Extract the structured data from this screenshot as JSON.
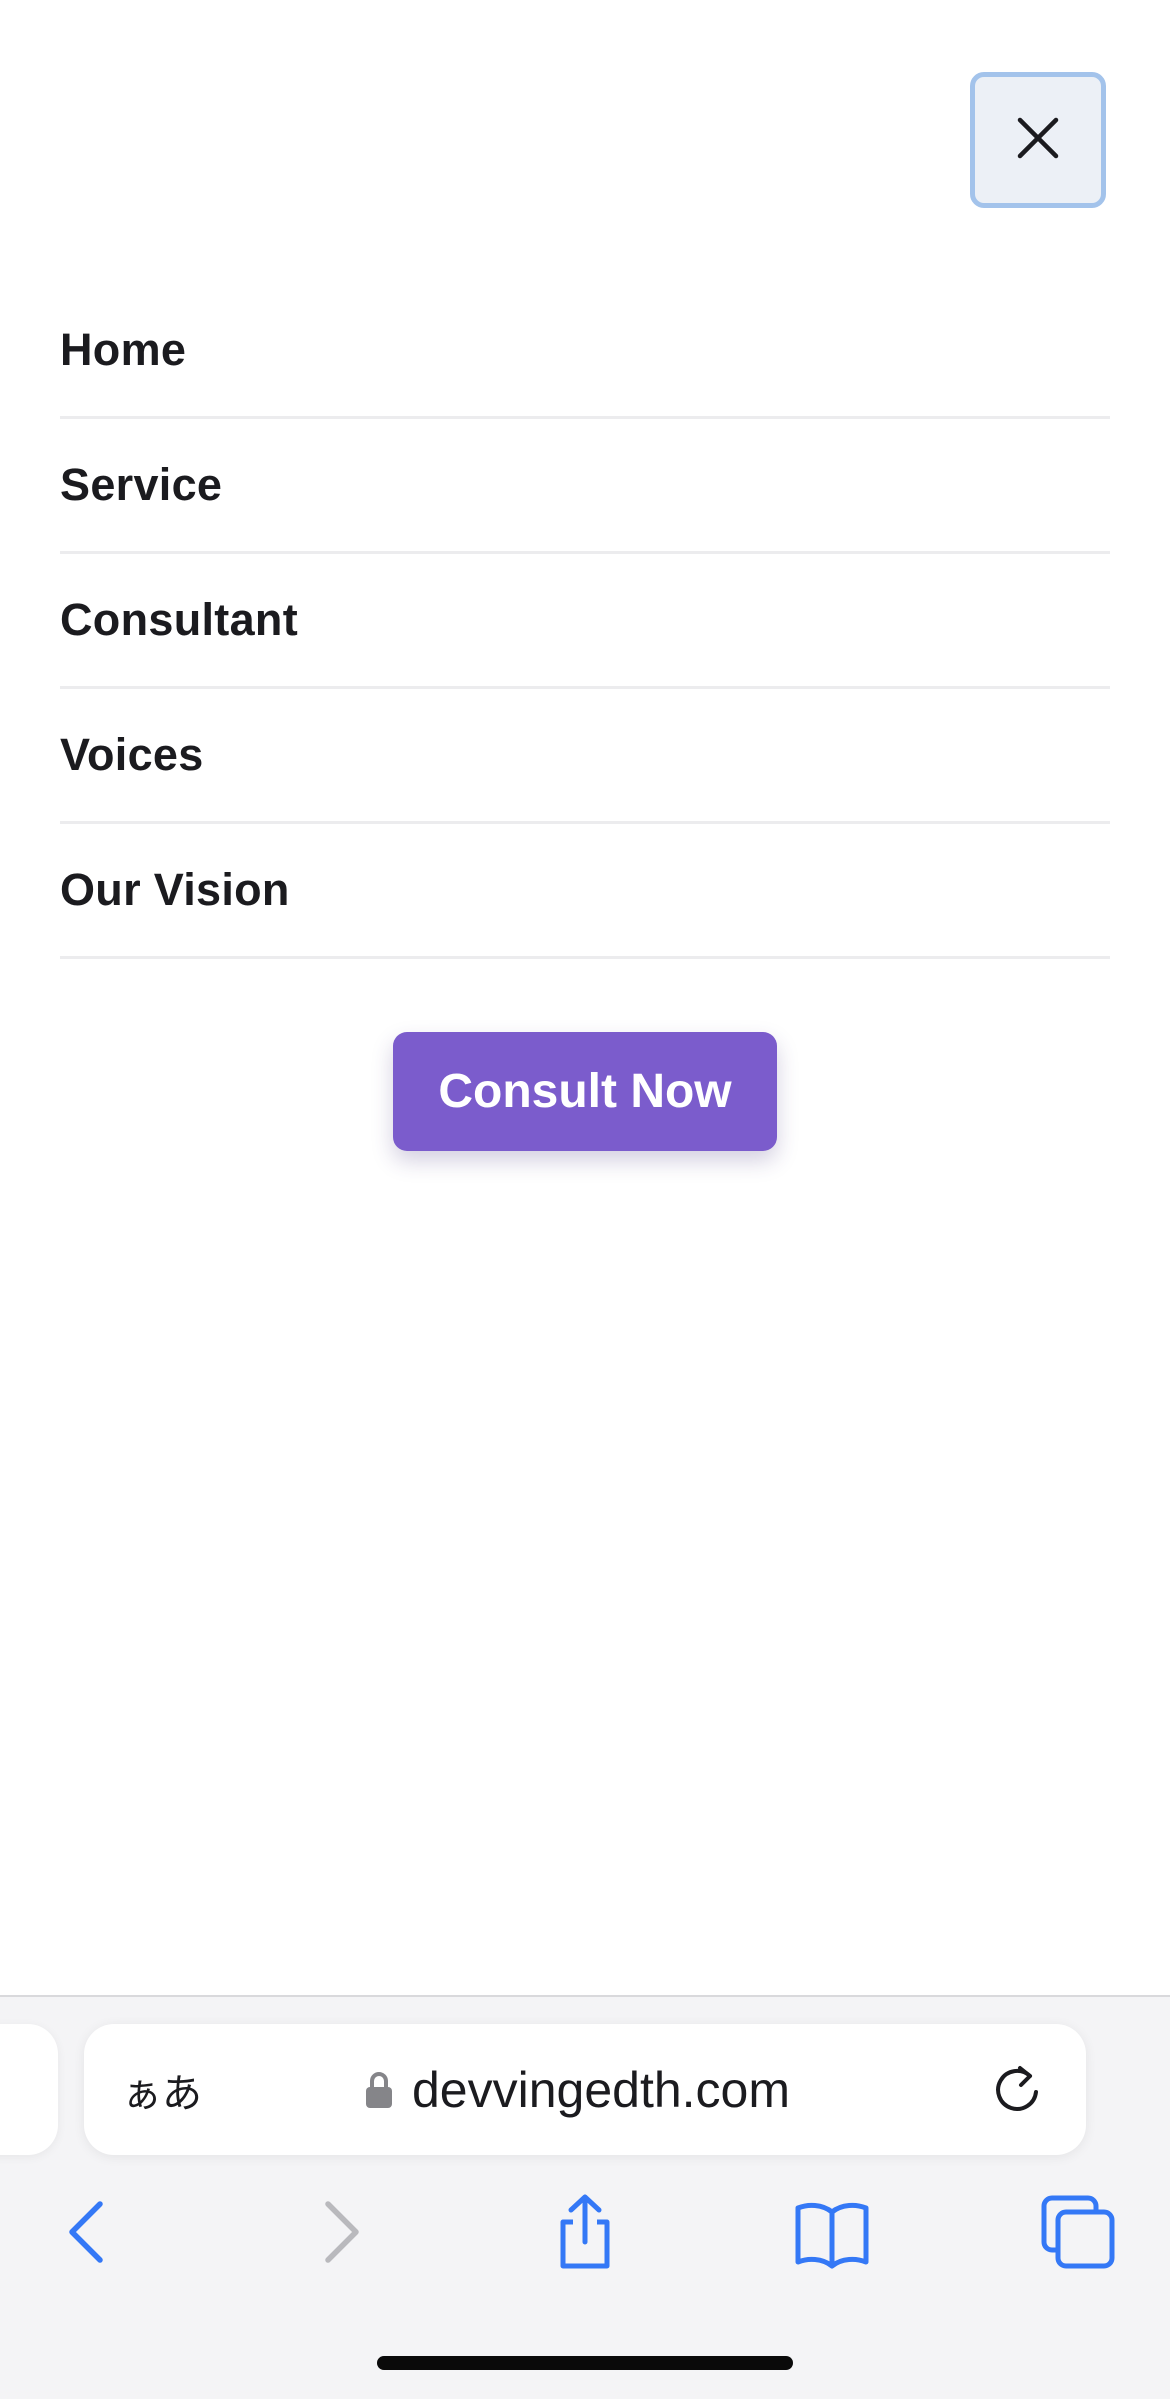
{
  "nav_menu": {
    "items": [
      {
        "label": "Home"
      },
      {
        "label": "Service"
      },
      {
        "label": "Consultant"
      },
      {
        "label": "Voices"
      },
      {
        "label": "Our Vision"
      }
    ],
    "cta_label": "Consult Now",
    "close_icon": "close-icon"
  },
  "browser": {
    "text_size_label": "ぁあ",
    "url": "devvingedth.com",
    "icons": [
      "lock-icon",
      "reload-icon",
      "back-icon",
      "forward-icon",
      "share-icon",
      "bookmarks-icon",
      "tabs-icon"
    ]
  },
  "colors": {
    "accent": "#7b5ccc",
    "ios_blue": "#3478f6",
    "close_border": "#a3c3eb"
  }
}
